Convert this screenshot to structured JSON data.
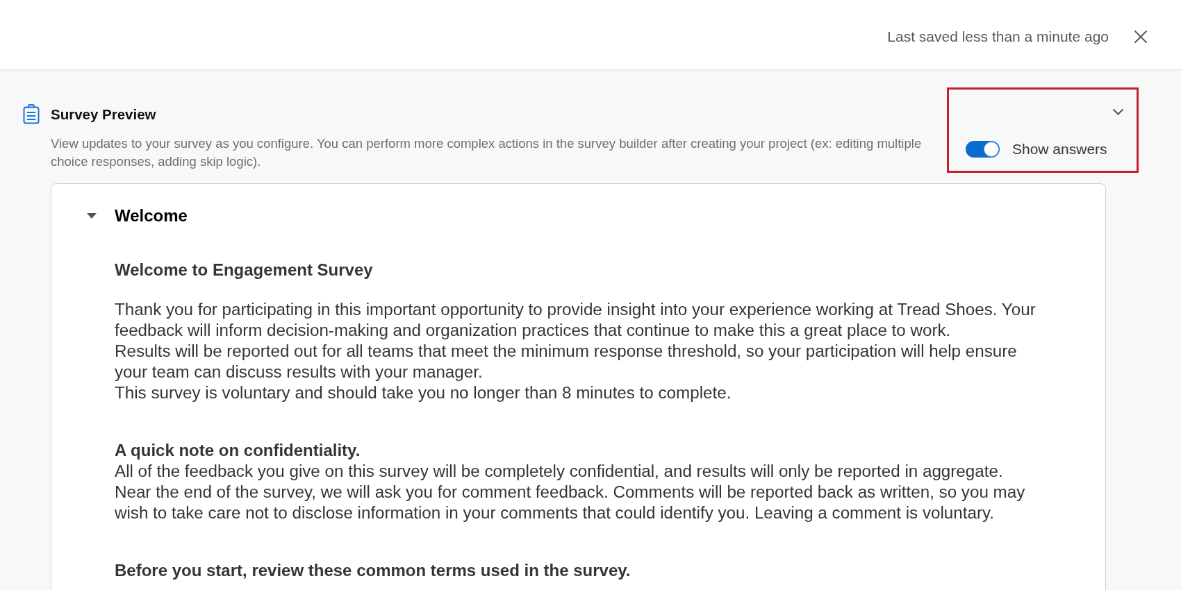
{
  "top_bar": {
    "save_status": "Last saved less than a minute ago"
  },
  "preview": {
    "title": "Survey Preview",
    "description": "View updates to your survey as you configure. You can perform more complex actions in the survey builder after creating your project (ex: editing multiple choice responses, adding skip logic).",
    "answers_toggle": {
      "label": "Show answers",
      "on": true,
      "highlighted": true
    }
  },
  "block": {
    "title": "Welcome",
    "expanded": true,
    "content": [
      {
        "kind": "title",
        "text": "Welcome to Engagement Survey"
      },
      {
        "kind": "paragraph",
        "text": "Thank you for participating in this important opportunity to provide insight into your experience working at Tread Shoes. Your feedback will inform decision-making and organization practices that continue to make this a great place to work."
      },
      {
        "kind": "paragraph",
        "text": "Results will be reported out for all teams that meet the minimum response threshold, so your participation will help ensure your team can discuss results with your manager."
      },
      {
        "kind": "paragraph",
        "text": "This survey is voluntary and should take you no longer than 8 minutes to complete."
      },
      {
        "kind": "heading",
        "text": "A quick note on confidentiality."
      },
      {
        "kind": "paragraph",
        "text": "All of the feedback you give on this survey will be completely confidential, and results will only be reported in aggregate."
      },
      {
        "kind": "paragraph",
        "text": "Near the end of the survey, we will ask you for comment feedback. Comments will be reported back as written, so you may wish to take care not to disclose information in your comments that could identify you. Leaving a comment is voluntary."
      },
      {
        "kind": "heading",
        "text": "Before you start, review these common terms used in the survey."
      }
    ]
  }
}
